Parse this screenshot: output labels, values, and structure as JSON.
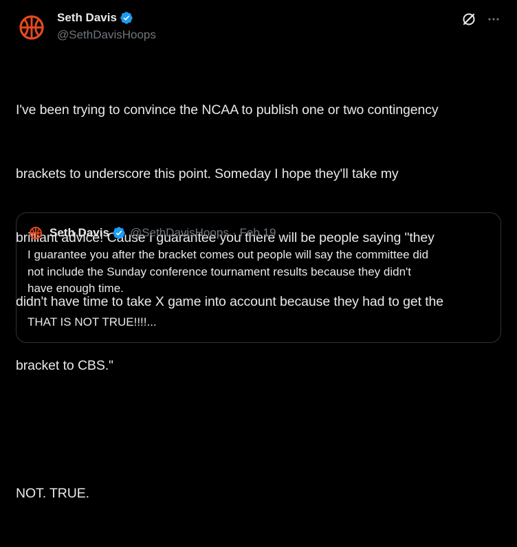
{
  "colors": {
    "background": "#000000",
    "text_primary": "#e7e9ea",
    "text_secondary": "#71767b",
    "verified_blue": "#1d9bf0",
    "avatar_orange": "#e8491d",
    "border": "#2f3336"
  },
  "tweet": {
    "author": {
      "display_name": "Seth Davis",
      "handle": "@SethDavisHoops",
      "avatar_icon": "basketball-icon",
      "verified": true
    },
    "actions": {
      "grok_icon": "grok-icon",
      "more_icon": "more-icon"
    },
    "body": {
      "line1": "I've been trying to convince the NCAA to publish one or two contingency",
      "line2": "brackets to underscore this point. Someday I hope they'll take my",
      "line3": "brilliant advice! Cause I guarantee you there will be people saying \"they",
      "line4": "didn't have time to take X game into account because they had to get the",
      "line5": "bracket to CBS.\"",
      "line6": "NOT. TRUE."
    }
  },
  "quote": {
    "author": {
      "display_name": "Seth Davis",
      "handle": "@SethDavisHoops",
      "separator": "·",
      "date": "Feb 19",
      "verified": true
    },
    "body": {
      "line1": "I guarantee you after the bracket comes out people will say the committee did",
      "line2": "not include the Sunday conference tournament results because they didn't",
      "line3": "have enough time.",
      "line4": "THAT IS NOT TRUE!!!!..."
    }
  }
}
